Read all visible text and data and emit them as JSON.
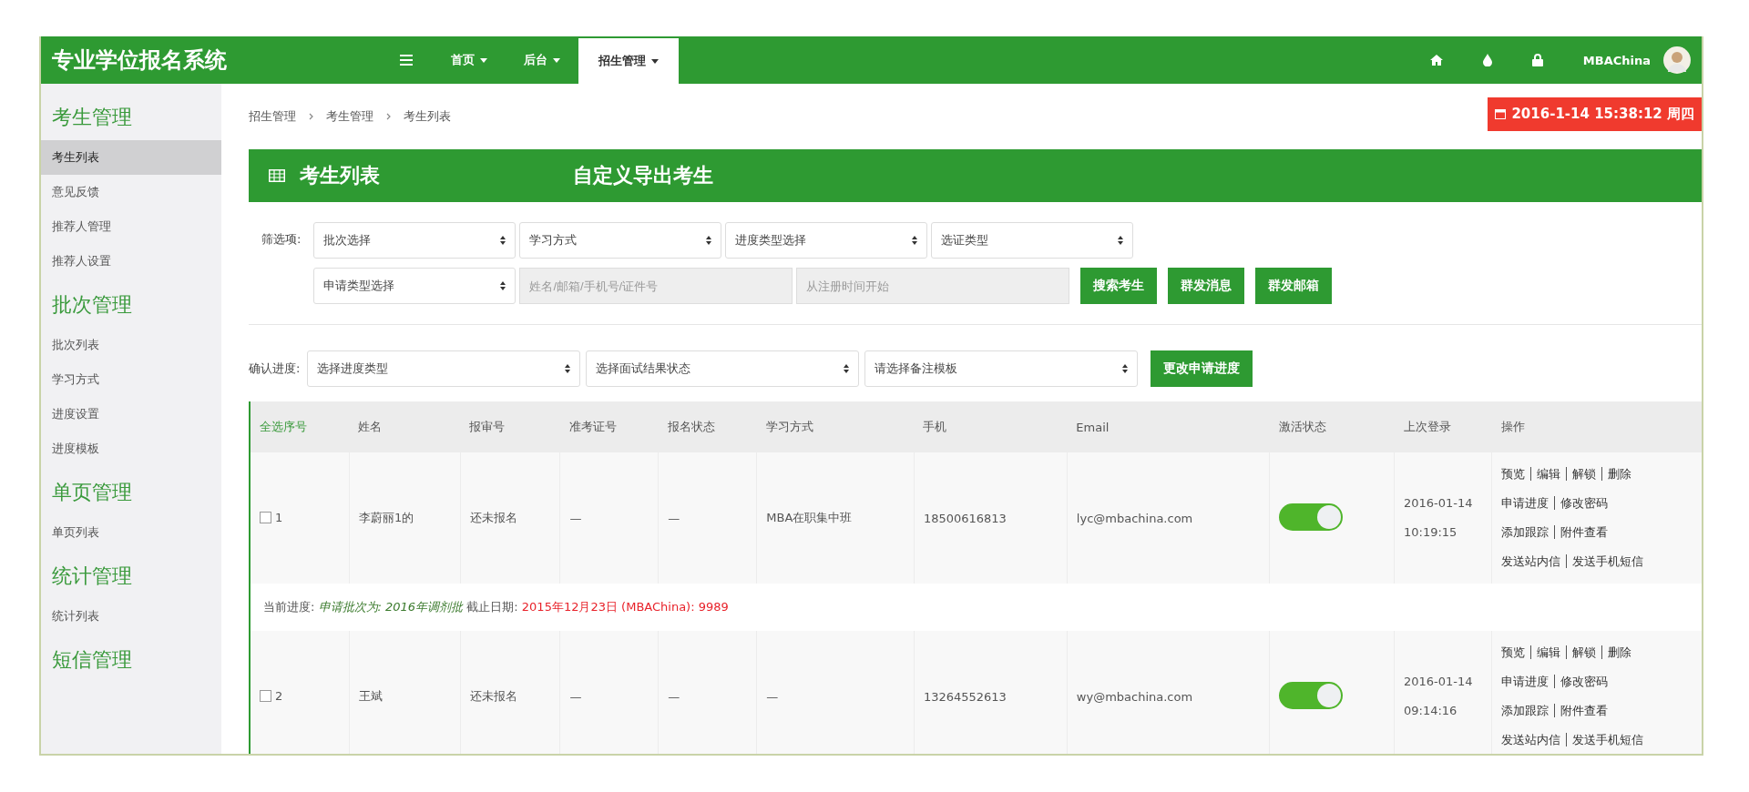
{
  "header": {
    "title": "专业学位报名系统",
    "nav": [
      {
        "label": "首页",
        "selected": false
      },
      {
        "label": "后台",
        "selected": false
      },
      {
        "label": "招生管理",
        "selected": true
      }
    ],
    "user": "MBAChina"
  },
  "sidebar": {
    "groups": [
      {
        "title": "考生管理",
        "items": [
          {
            "label": "考生列表",
            "selected": true
          },
          {
            "label": "意见反馈",
            "selected": false
          },
          {
            "label": "推荐人管理",
            "selected": false
          },
          {
            "label": "推荐人设置",
            "selected": false
          }
        ]
      },
      {
        "title": "批次管理",
        "items": [
          {
            "label": "批次列表",
            "selected": false
          },
          {
            "label": "学习方式",
            "selected": false
          },
          {
            "label": "进度设置",
            "selected": false
          },
          {
            "label": "进度模板",
            "selected": false
          }
        ]
      },
      {
        "title": "单页管理",
        "items": [
          {
            "label": "单页列表",
            "selected": false
          }
        ]
      },
      {
        "title": "统计管理",
        "items": [
          {
            "label": "统计列表",
            "selected": false
          }
        ]
      },
      {
        "title": "短信管理"
      }
    ]
  },
  "breadcrumb": [
    "招生管理",
    "考生管理",
    "考生列表"
  ],
  "datetime": "2016-1-14 15:38:12 周四",
  "panel": {
    "title": "考生列表",
    "export_link": "自定义导出考生"
  },
  "filters": {
    "label": "筛选项:",
    "rows": [
      [
        {
          "kind": "select",
          "text": "批次选择"
        },
        {
          "kind": "select",
          "text": "学习方式"
        },
        {
          "kind": "select",
          "text": "进度类型选择"
        },
        {
          "kind": "select",
          "text": "选证类型"
        }
      ],
      [
        {
          "kind": "select",
          "text": "申请类型选择"
        },
        {
          "kind": "input",
          "placeholder": "姓名/邮箱/手机号/证件号"
        },
        {
          "kind": "input",
          "placeholder": "从注册时间开始"
        },
        {
          "kind": "button",
          "text": "搜索考生"
        },
        {
          "kind": "button",
          "text": "群发消息"
        },
        {
          "kind": "button",
          "text": "群发邮箱"
        }
      ]
    ]
  },
  "progress_controls": {
    "label": "确认进度:",
    "selects": [
      "选择进度类型",
      "选择面试结果状态",
      "请选择备注模板"
    ],
    "button": "更改申请进度"
  },
  "table": {
    "columns": [
      "全选序号",
      "姓名",
      "报审号",
      "准考证号",
      "报名状态",
      "学习方式",
      "手机",
      "Email",
      "激活状态",
      "上次登录",
      "操作"
    ],
    "rows": [
      {
        "checked": false,
        "index": "1",
        "name": "李蔚丽1的",
        "reg_status_note": "还未报名",
        "exam_no": "—",
        "status": "—",
        "study_mode": "MBA在职集中班",
        "phone": "18500616813",
        "email": "lyc@mbachina.com",
        "active": true,
        "last_login": "2016-01-14 10:19:15",
        "actions": [
          [
            "预览",
            "编辑",
            "解锁",
            "删除"
          ],
          [
            "申请进度",
            "修改密码"
          ],
          [
            "添加跟踪",
            "附件查看"
          ],
          [
            "发送站内信",
            "发送手机短信"
          ]
        ],
        "progress_note": {
          "label": "当前进度:",
          "batch": "申请批次为: 2016年调剂批",
          "deadline_label": "截止日期:",
          "deadline": "2015年12月23日 (MBAChina): 9989"
        }
      },
      {
        "checked": false,
        "index": "2",
        "name": "王斌",
        "reg_status_note": "还未报名",
        "exam_no": "—",
        "status": "—",
        "study_mode": "—",
        "phone": "13264552613",
        "email": "wy@mbachina.com",
        "active": true,
        "last_login": "2016-01-14 09:14:16",
        "actions": [
          [
            "预览",
            "编辑",
            "解锁",
            "删除"
          ],
          [
            "申请进度",
            "修改密码"
          ],
          [
            "添加跟踪",
            "附件查看"
          ],
          [
            "发送站内信",
            "发送手机短信"
          ]
        ]
      }
    ]
  }
}
